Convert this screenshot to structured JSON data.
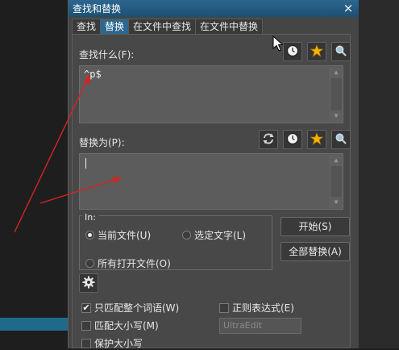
{
  "dialog": {
    "title": "查找和替换",
    "close_glyph": "×",
    "tabs": [
      "查找",
      "替换",
      "在文件中查找",
      "在文件中替换"
    ],
    "active_tab": 1
  },
  "find": {
    "label": "查找什么(F):",
    "value": "^p$"
  },
  "replace": {
    "label": "替换为(P):",
    "value": ""
  },
  "scope": {
    "label": "In:",
    "options": [
      "当前文件(U)",
      "选定文字(L)",
      "所有打开文件(O)"
    ],
    "selected": 0
  },
  "buttons": {
    "start": "开始(S)",
    "replace_all": "全部替换(A)"
  },
  "options": {
    "match_whole_word": "只匹配整个词语(W)",
    "match_case": "匹配大小写(M)",
    "preserve_case": "保护大小写",
    "regex": "正则表达式(E)",
    "regex_engine": "UltraEdit"
  },
  "icons": {
    "history": "history-clock-icon",
    "favorites": "favorite-star-icon",
    "search": "magnifier-icon",
    "swap": "swap-arrows-icon",
    "settings": "gear-icon"
  },
  "colors": {
    "titlebar": "#2c6790",
    "annotation_arrow": "#d42424"
  }
}
